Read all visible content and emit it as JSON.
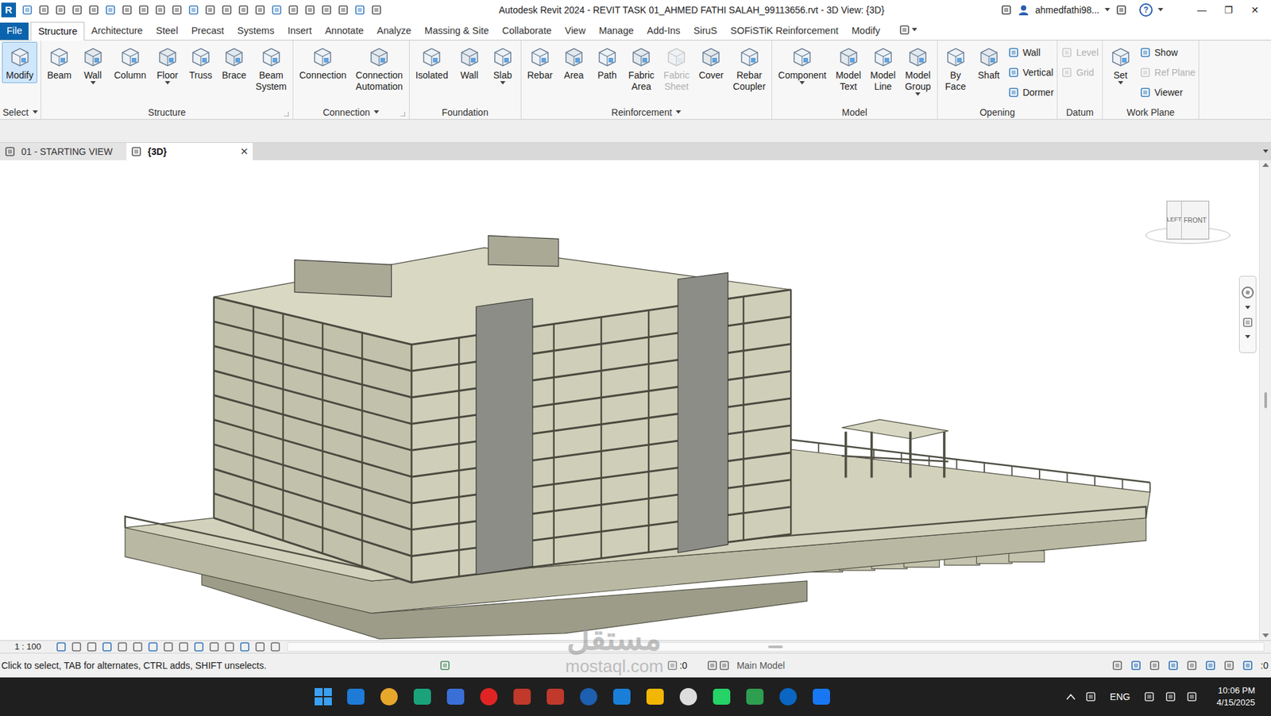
{
  "app": {
    "logo": "R",
    "title": "Autodesk Revit 2024 - REVIT TASK 01_AHMED FATHI SALAH_99113656.rvt - 3D View: {3D}",
    "user": "ahmedfathi98...",
    "help": "?",
    "window_controls": [
      "—",
      "❐",
      "✕"
    ]
  },
  "ribbon_tabs": [
    {
      "label": "File",
      "selected": false,
      "kind": "file"
    },
    {
      "label": "Structure",
      "selected": true,
      "kind": "tab"
    },
    {
      "label": "Architecture",
      "selected": false,
      "kind": "tab"
    },
    {
      "label": "Steel",
      "selected": false,
      "kind": "tab"
    },
    {
      "label": "Precast",
      "selected": false,
      "kind": "tab"
    },
    {
      "label": "Systems",
      "selected": false,
      "kind": "tab"
    },
    {
      "label": "Insert",
      "selected": false,
      "kind": "tab"
    },
    {
      "label": "Annotate",
      "selected": false,
      "kind": "tab"
    },
    {
      "label": "Analyze",
      "selected": false,
      "kind": "tab"
    },
    {
      "label": "Massing & Site",
      "selected": false,
      "kind": "tab"
    },
    {
      "label": "Collaborate",
      "selected": false,
      "kind": "tab"
    },
    {
      "label": "View",
      "selected": false,
      "kind": "tab"
    },
    {
      "label": "Manage",
      "selected": false,
      "kind": "tab"
    },
    {
      "label": "Add-Ins",
      "selected": false,
      "kind": "tab"
    },
    {
      "label": "SiruS",
      "selected": false,
      "kind": "tab"
    },
    {
      "label": "SOFiSTiK Reinforcement",
      "selected": false,
      "kind": "tab"
    },
    {
      "label": "Modify",
      "selected": false,
      "kind": "tab"
    }
  ],
  "ribbon_panels": [
    {
      "title": "Select",
      "dropdown": true,
      "launcher": false,
      "items": [
        {
          "label": "Modify",
          "kind": "large",
          "selected": true,
          "disabled": false,
          "dropdown": false
        }
      ]
    },
    {
      "title": "Structure",
      "dropdown": false,
      "launcher": true,
      "items": [
        {
          "label": "Beam",
          "kind": "large",
          "selected": false,
          "disabled": false,
          "dropdown": false
        },
        {
          "label": "Wall",
          "kind": "large",
          "selected": false,
          "disabled": false,
          "dropdown": true
        },
        {
          "label": "Column",
          "kind": "large",
          "selected": false,
          "disabled": false,
          "dropdown": false
        },
        {
          "label": "Floor",
          "kind": "large",
          "selected": false,
          "disabled": false,
          "dropdown": true
        },
        {
          "label": "Truss",
          "kind": "large",
          "selected": false,
          "disabled": false,
          "dropdown": false
        },
        {
          "label": "Brace",
          "kind": "large",
          "selected": false,
          "disabled": false,
          "dropdown": false
        },
        {
          "label": "Beam System",
          "kind": "large",
          "selected": false,
          "disabled": false,
          "dropdown": false
        }
      ]
    },
    {
      "title": "Connection",
      "dropdown": true,
      "launcher": true,
      "items": [
        {
          "label": "Connection",
          "kind": "large",
          "selected": false,
          "disabled": false,
          "dropdown": false
        },
        {
          "label": "Connection Automation",
          "kind": "large",
          "selected": false,
          "disabled": false,
          "dropdown": false
        }
      ]
    },
    {
      "title": "Foundation",
      "dropdown": false,
      "launcher": false,
      "items": [
        {
          "label": "Isolated",
          "kind": "large",
          "selected": false,
          "disabled": false,
          "dropdown": false
        },
        {
          "label": "Wall",
          "kind": "large",
          "selected": false,
          "disabled": false,
          "dropdown": false
        },
        {
          "label": "Slab",
          "kind": "large",
          "selected": false,
          "disabled": false,
          "dropdown": true
        }
      ]
    },
    {
      "title": "Reinforcement",
      "dropdown": true,
      "launcher": false,
      "items": [
        {
          "label": "Rebar",
          "kind": "large",
          "selected": false,
          "disabled": false,
          "dropdown": false
        },
        {
          "label": "Area",
          "kind": "large",
          "selected": false,
          "disabled": false,
          "dropdown": false
        },
        {
          "label": "Path",
          "kind": "large",
          "selected": false,
          "disabled": false,
          "dropdown": false
        },
        {
          "label": "Fabric Area",
          "kind": "large",
          "selected": false,
          "disabled": false,
          "dropdown": false
        },
        {
          "label": "Fabric Sheet",
          "kind": "large",
          "selected": false,
          "disabled": true,
          "dropdown": false
        },
        {
          "label": "Cover",
          "kind": "large",
          "selected": false,
          "disabled": false,
          "dropdown": false
        },
        {
          "label": "Rebar Coupler",
          "kind": "large",
          "selected": false,
          "disabled": false,
          "dropdown": false
        }
      ]
    },
    {
      "title": "Model",
      "dropdown": false,
      "launcher": false,
      "items": [
        {
          "label": "Component",
          "kind": "large",
          "selected": false,
          "disabled": false,
          "dropdown": true
        },
        {
          "label": "Model Text",
          "kind": "large",
          "selected": false,
          "disabled": false,
          "dropdown": false
        },
        {
          "label": "Model Line",
          "kind": "large",
          "selected": false,
          "disabled": false,
          "dropdown": false
        },
        {
          "label": "Model Group",
          "kind": "large",
          "selected": false,
          "disabled": false,
          "dropdown": true
        }
      ]
    },
    {
      "title": "Opening",
      "dropdown": false,
      "launcher": false,
      "items": [
        {
          "label": "By Face",
          "kind": "large",
          "selected": false,
          "disabled": false,
          "dropdown": false
        },
        {
          "label": "Shaft",
          "kind": "large",
          "selected": false,
          "disabled": false,
          "dropdown": false
        },
        {
          "label": "Wall",
          "kind": "small",
          "selected": false,
          "disabled": false,
          "dropdown": false
        },
        {
          "label": "Vertical",
          "kind": "small",
          "selected": false,
          "disabled": false,
          "dropdown": false
        },
        {
          "label": "Dormer",
          "kind": "small",
          "selected": false,
          "disabled": false,
          "dropdown": false
        }
      ]
    },
    {
      "title": "Datum",
      "dropdown": false,
      "launcher": false,
      "items": [
        {
          "label": "Level",
          "kind": "small",
          "selected": false,
          "disabled": true,
          "dropdown": false
        },
        {
          "label": "Grid",
          "kind": "small",
          "selected": false,
          "disabled": true,
          "dropdown": false
        }
      ]
    },
    {
      "title": "Work Plane",
      "dropdown": false,
      "launcher": false,
      "items": [
        {
          "label": "Set",
          "kind": "large",
          "selected": false,
          "disabled": false,
          "dropdown": true
        },
        {
          "label": "Show",
          "kind": "small",
          "selected": false,
          "disabled": false,
          "dropdown": false
        },
        {
          "label": "Ref Plane",
          "kind": "small",
          "selected": false,
          "disabled": true,
          "dropdown": false
        },
        {
          "label": "Viewer",
          "kind": "small",
          "selected": false,
          "disabled": false,
          "dropdown": false
        }
      ]
    }
  ],
  "view_tabs": [
    {
      "label": "01 - STARTING VIEW",
      "selected": false,
      "close": ""
    },
    {
      "label": "{3D}",
      "selected": true,
      "close": "✕"
    }
  ],
  "viewcube": {
    "left": "LEFT",
    "front": "FRONT"
  },
  "view_control": {
    "scale": "1 : 100"
  },
  "status_bar": {
    "message": "Click to select, TAB for alternates, CTRL adds, SHIFT unselects.",
    "selection_count": ":0",
    "model": "Main Model",
    "filter_count": ":0"
  },
  "watermark": {
    "arabic": "مستقل",
    "latin": "mostaql.com"
  },
  "taskbar": {
    "language": "ENG",
    "time": "10:06 PM",
    "date": "4/15/2025"
  }
}
